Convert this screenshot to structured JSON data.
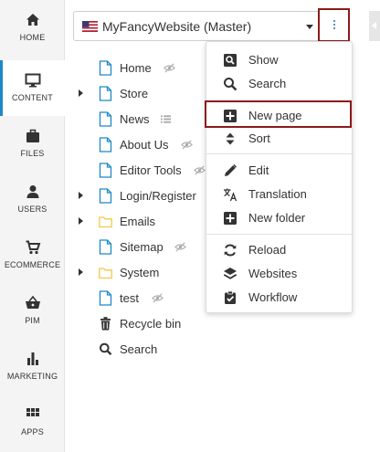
{
  "nav": {
    "items": [
      {
        "label": "HOME",
        "icon": "home-icon"
      },
      {
        "label": "CONTENT",
        "icon": "monitor-icon",
        "active": true
      },
      {
        "label": "FILES",
        "icon": "briefcase-icon"
      },
      {
        "label": "USERS",
        "icon": "user-icon"
      },
      {
        "label": "ECOMMERCE",
        "icon": "cart-icon"
      },
      {
        "label": "PIM",
        "icon": "basket-icon"
      },
      {
        "label": "MARKETING",
        "icon": "bar-chart-icon"
      },
      {
        "label": "APPS",
        "icon": "grid-icon"
      }
    ]
  },
  "site_selector": {
    "value": "MyFancyWebsite (Master)",
    "flag": "us-flag-icon"
  },
  "tree": {
    "items": [
      {
        "label": "Home",
        "icon": "page-icon",
        "hidden": true
      },
      {
        "label": "Store",
        "icon": "page-icon",
        "expandable": true
      },
      {
        "label": "News",
        "icon": "page-icon",
        "list": true
      },
      {
        "label": "About Us",
        "icon": "page-icon",
        "hidden": true
      },
      {
        "label": "Editor Tools",
        "icon": "page-icon",
        "hidden": true
      },
      {
        "label": "Login/Register",
        "icon": "page-icon",
        "expandable": true
      },
      {
        "label": "Emails",
        "icon": "folder-icon",
        "expandable": true
      },
      {
        "label": "Sitemap",
        "icon": "page-icon",
        "hidden": true
      },
      {
        "label": "System",
        "icon": "folder-icon",
        "expandable": true
      },
      {
        "label": "test",
        "icon": "page-icon",
        "hidden": true
      },
      {
        "label": "Recycle bin",
        "icon": "trash-icon"
      },
      {
        "label": "Search",
        "icon": "search-icon"
      }
    ]
  },
  "menu": {
    "groups": [
      [
        {
          "label": "Show",
          "icon": "preview-icon"
        },
        {
          "label": "Search",
          "icon": "search-icon"
        }
      ],
      [
        {
          "label": "New page",
          "icon": "plus-square-icon"
        },
        {
          "label": "Sort",
          "icon": "sort-icon"
        }
      ],
      [
        {
          "label": "Edit",
          "icon": "pencil-icon"
        },
        {
          "label": "Translation",
          "icon": "translate-icon"
        },
        {
          "label": "New folder",
          "icon": "plus-square-icon"
        }
      ],
      [
        {
          "label": "Reload",
          "icon": "reload-icon"
        },
        {
          "label": "Websites",
          "icon": "layers-icon"
        },
        {
          "label": "Workflow",
          "icon": "clipboard-check-icon"
        }
      ]
    ]
  },
  "colors": {
    "accent": "#1e88c9",
    "page_icon": "#1e88c9",
    "folder_icon": "#f2c94c",
    "highlight_border": "#8b1a1a",
    "rail_bg": "#f4f4f4"
  }
}
